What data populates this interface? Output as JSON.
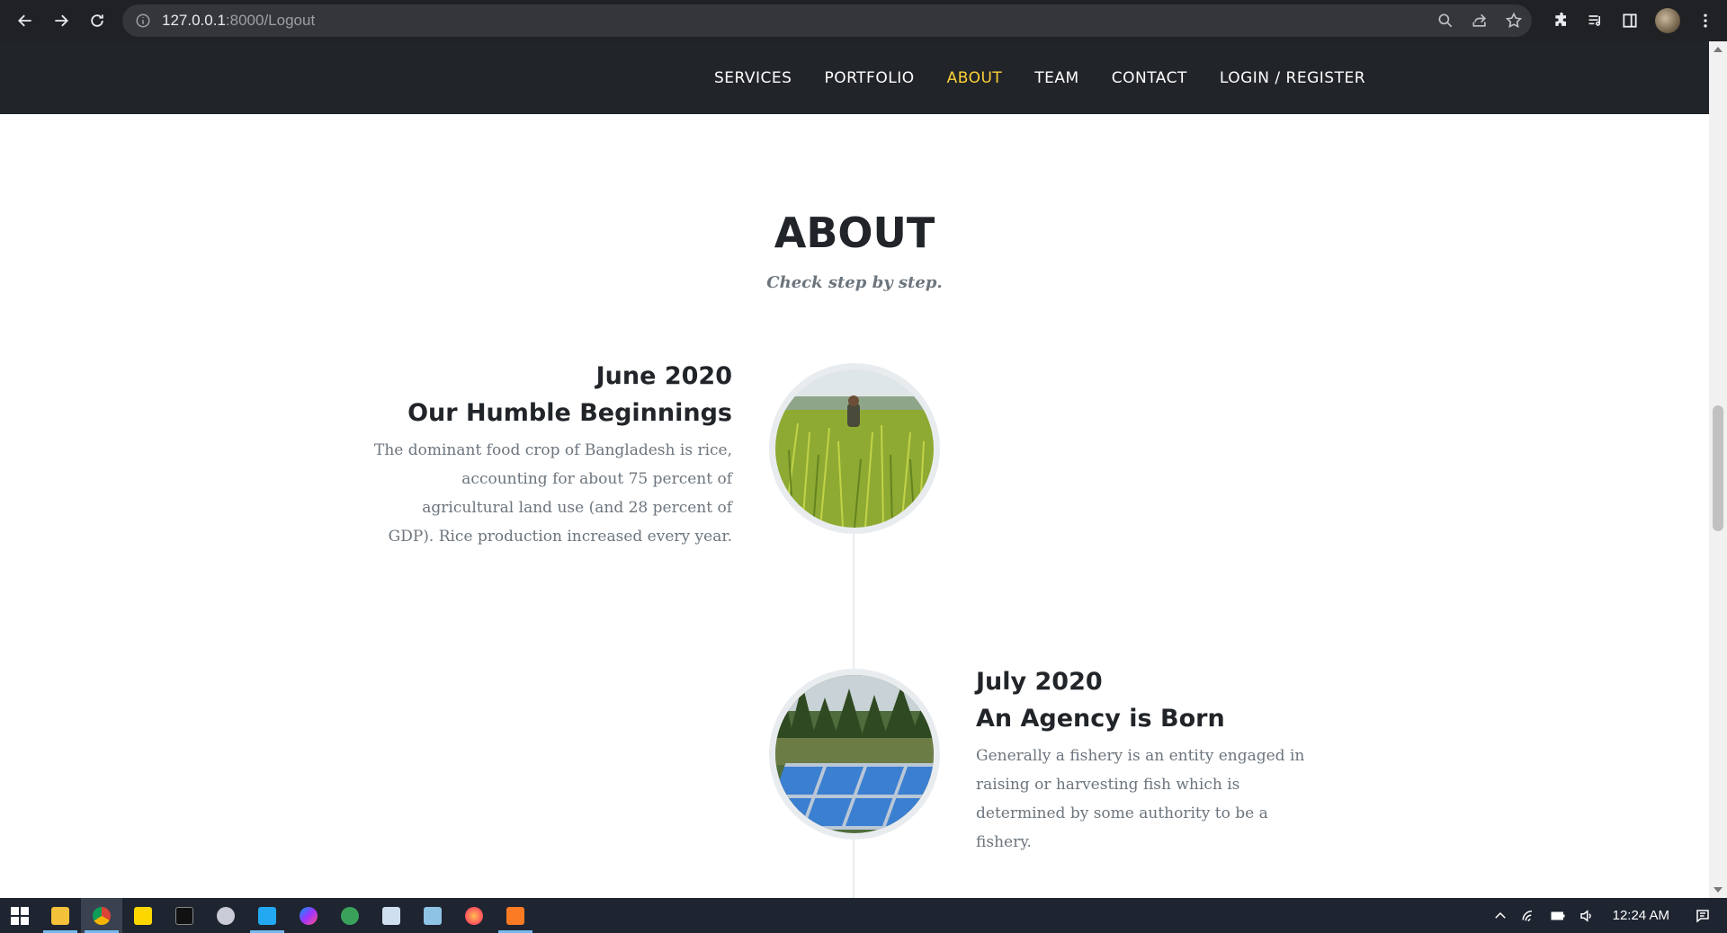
{
  "browser": {
    "url_host": "127.0.0.1",
    "url_rest": ":8000/Logout"
  },
  "nav": {
    "items": [
      {
        "label": "SERVICES",
        "active": false
      },
      {
        "label": "PORTFOLIO",
        "active": false
      },
      {
        "label": "ABOUT",
        "active": true
      },
      {
        "label": "TEAM",
        "active": false
      },
      {
        "label": "CONTACT",
        "active": false
      },
      {
        "label": "LOGIN / REGISTER",
        "active": false
      }
    ],
    "active_color": "#fed136"
  },
  "about": {
    "title": "ABOUT",
    "subtitle": "Check step by step.",
    "timeline": [
      {
        "date": "June 2020",
        "heading": "Our Humble Beginnings",
        "body": "The dominant food crop of Bangladesh is rice, accounting for about 75 percent of agricultural land use (and 28 percent of GDP). Rice production increased every year.",
        "image": "rice-field-photo"
      },
      {
        "date": "July 2020",
        "heading": "An Agency is Born",
        "body": "Generally a fishery is an entity engaged in raising or harvesting fish which is determined by some authority to be a fishery.",
        "image": "fishery-photo"
      }
    ]
  },
  "taskbar": {
    "clock": "12:24 AM"
  }
}
